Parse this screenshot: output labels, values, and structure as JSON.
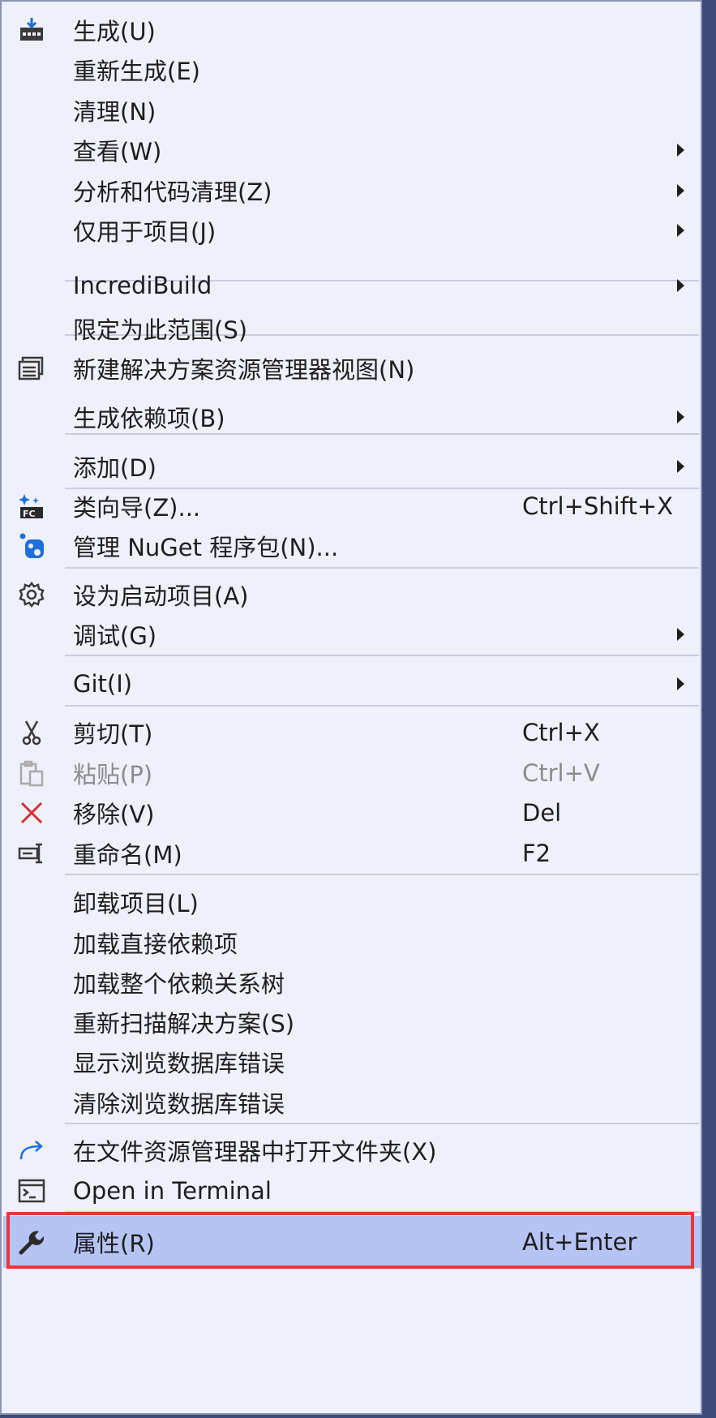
{
  "menu": {
    "items": [
      {
        "label": "生成(U)",
        "icon": "build-icon"
      },
      {
        "label": "重新生成(E)"
      },
      {
        "label": "清理(N)"
      },
      {
        "label": "查看(W)",
        "submenu": true
      },
      {
        "label": "分析和代码清理(Z)",
        "submenu": true
      },
      {
        "label": "仅用于项目(J)",
        "submenu": true
      },
      {
        "label": "IncrediBuild",
        "submenu": true
      },
      {
        "label": "限定为此范围(S)"
      },
      {
        "label": "新建解决方案资源管理器视图(N)",
        "icon": "new-view-icon"
      },
      {
        "label": "生成依赖项(B)",
        "submenu": true
      },
      {
        "label": "添加(D)",
        "submenu": true
      },
      {
        "label": "类向导(Z)...",
        "shortcut": "Ctrl+Shift+X",
        "icon": "class-wizard-icon"
      },
      {
        "label": "管理 NuGet 程序包(N)...",
        "icon": "nuget-icon"
      },
      {
        "label": "设为启动项目(A)",
        "icon": "gear-icon"
      },
      {
        "label": "调试(G)",
        "submenu": true
      },
      {
        "label": "Git(I)",
        "submenu": true
      },
      {
        "label": "剪切(T)",
        "shortcut": "Ctrl+X",
        "icon": "scissors-icon"
      },
      {
        "label": "粘贴(P)",
        "shortcut": "Ctrl+V",
        "icon": "paste-icon",
        "disabled": true
      },
      {
        "label": "移除(V)",
        "shortcut": "Del",
        "icon": "remove-icon"
      },
      {
        "label": "重命名(M)",
        "shortcut": "F2",
        "icon": "rename-icon"
      },
      {
        "label": "卸载项目(L)"
      },
      {
        "label": "加载直接依赖项"
      },
      {
        "label": "加载整个依赖关系树"
      },
      {
        "label": "重新扫描解决方案(S)"
      },
      {
        "label": "显示浏览数据库错误"
      },
      {
        "label": "清除浏览数据库错误"
      },
      {
        "label": "在文件资源管理器中打开文件夹(X)",
        "icon": "open-folder-arrow-icon"
      },
      {
        "label": "Open in Terminal",
        "icon": "terminal-icon"
      },
      {
        "label": "属性(R)",
        "shortcut": "Alt+Enter",
        "icon": "wrench-icon",
        "highlighted": true
      }
    ]
  },
  "colors": {
    "menu_bg": "#eef0fa",
    "highlight": "#b6c4f5",
    "annotation_red": "#e53935",
    "icon_blue": "#1e6fd9"
  }
}
